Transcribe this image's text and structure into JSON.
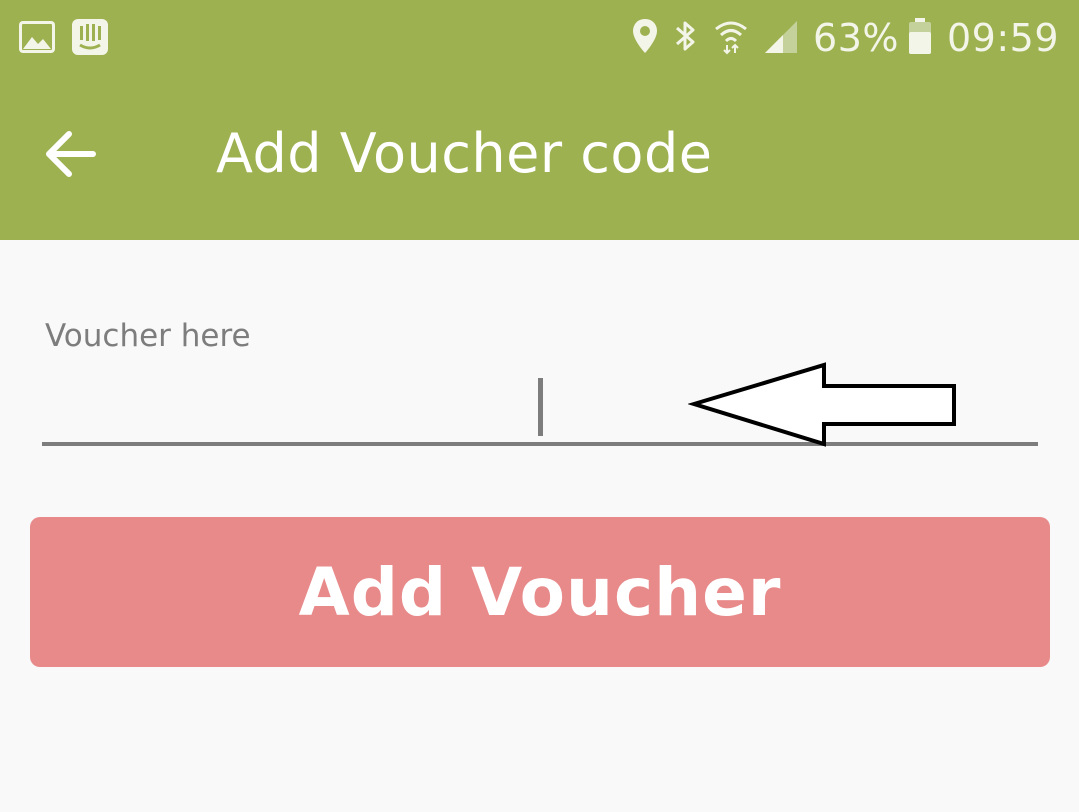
{
  "status_bar": {
    "battery_percent": "63%",
    "time": "09:59",
    "icons": [
      "gallery-icon",
      "intercom-icon",
      "location-icon",
      "bluetooth-icon",
      "wifi-icon",
      "signal-icon",
      "battery-icon"
    ]
  },
  "toolbar": {
    "title": "Add Voucher code",
    "back_icon": "arrow-left-icon"
  },
  "form": {
    "voucher_label": "Voucher here",
    "voucher_value": "",
    "submit_label": "Add Voucher"
  },
  "colors": {
    "appbar": "#9db151",
    "button": "#e8898a",
    "background": "#f9f9f9",
    "underline": "#7d7d7d"
  }
}
